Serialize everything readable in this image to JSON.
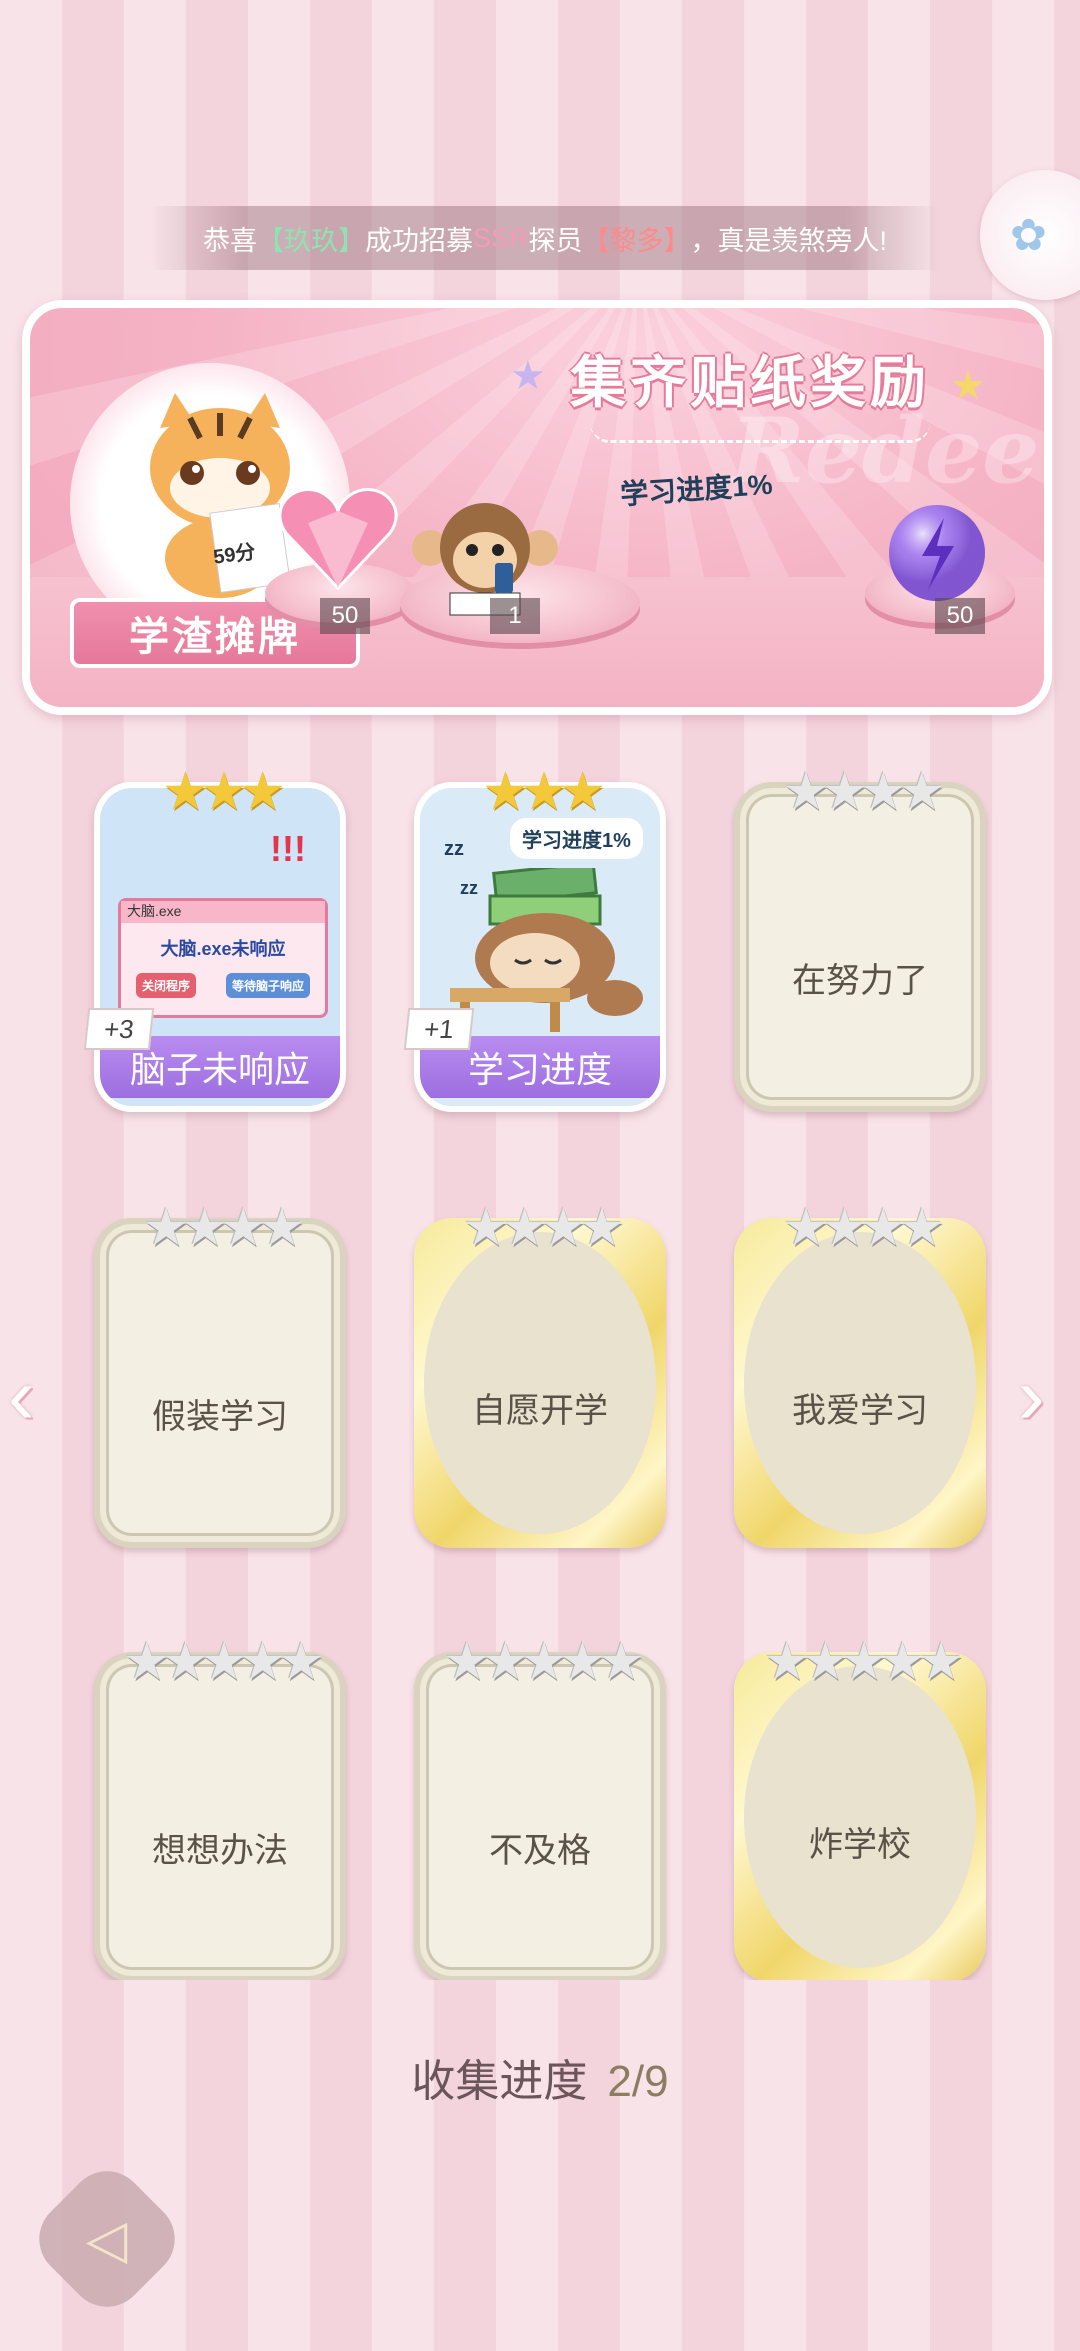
{
  "ticker": {
    "prefix": "恭喜",
    "user": "【玖玖】",
    "middle": "成功招募",
    "rarity": "SSR",
    "role": "探员",
    "recruit": "【黎多】",
    "suffix": "，真是羡煞旁人!"
  },
  "reward_panel": {
    "title": "集齐贴纸奖励",
    "watermark": "Redeem",
    "tiger_paper": "59分",
    "tiger_label": "学渣摊牌",
    "monkey_label": "学习进度1%",
    "rewards": [
      {
        "icon": "heart-gem-icon",
        "count": "50"
      },
      {
        "icon": "monkey-sticker-icon",
        "count": "1"
      },
      {
        "icon": "purple-orb-icon",
        "count": "50"
      }
    ]
  },
  "stickers": [
    {
      "name": "脑子未响应",
      "collected": true,
      "plus": "+3",
      "stars": 3,
      "window_title": "大脑.exe",
      "window_msg": "大脑.exe未响应",
      "btn_close": "关闭程序",
      "btn_wait": "等待脑子响应"
    },
    {
      "name": "学习进度",
      "collected": true,
      "plus": "+1",
      "stars": 3,
      "bubble": "学习进度1%",
      "zz1": "zz",
      "zz2": "zz"
    },
    {
      "name": "在努力了",
      "collected": false,
      "stars": 4
    },
    {
      "name": "假装学习",
      "collected": false,
      "stars": 4
    },
    {
      "name": "自愿开学",
      "collected": false,
      "stars": 4
    },
    {
      "name": "我爱学习",
      "collected": false,
      "stars": 4
    },
    {
      "name": "想想办法",
      "collected": false,
      "stars": 5
    },
    {
      "name": "不及格",
      "collected": false,
      "stars": 5
    },
    {
      "name": "炸学校",
      "collected": false,
      "stars": 5
    }
  ],
  "nav": {
    "prev": "‹",
    "next": "›"
  },
  "progress": {
    "label": "收集进度",
    "value": "2/9"
  },
  "back_icon": "◁",
  "star_glyphs": {
    "three": "★★★",
    "four": "★★★★",
    "five": "★★★★★"
  },
  "colors": {
    "accent_pink": "#e57b9c",
    "ribbon_purple": "#9d6ee0",
    "gold": "#f3c93a"
  }
}
